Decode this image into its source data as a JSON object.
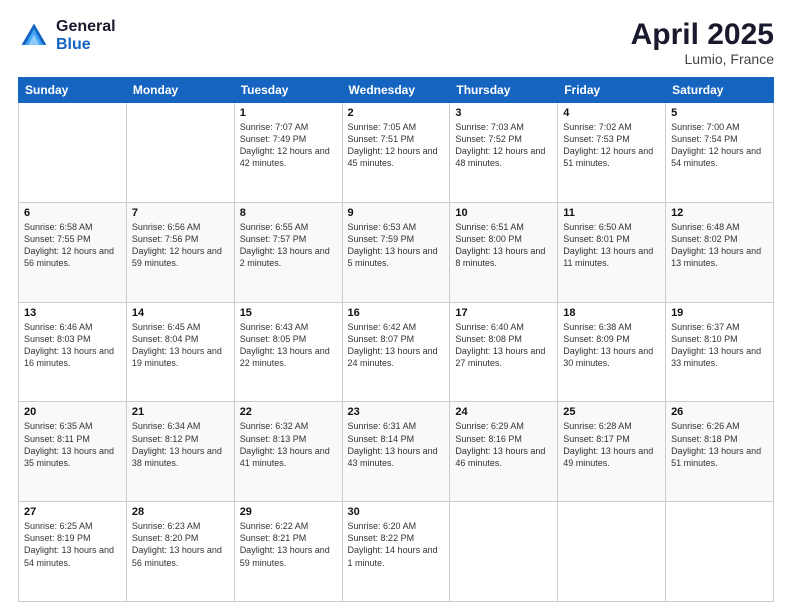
{
  "logo": {
    "general": "General",
    "blue": "Blue"
  },
  "title": "April 2025",
  "location": "Lumio, France",
  "days_of_week": [
    "Sunday",
    "Monday",
    "Tuesday",
    "Wednesday",
    "Thursday",
    "Friday",
    "Saturday"
  ],
  "weeks": [
    [
      {
        "day": "",
        "info": ""
      },
      {
        "day": "",
        "info": ""
      },
      {
        "day": "1",
        "info": "Sunrise: 7:07 AM\nSunset: 7:49 PM\nDaylight: 12 hours and 42 minutes."
      },
      {
        "day": "2",
        "info": "Sunrise: 7:05 AM\nSunset: 7:51 PM\nDaylight: 12 hours and 45 minutes."
      },
      {
        "day": "3",
        "info": "Sunrise: 7:03 AM\nSunset: 7:52 PM\nDaylight: 12 hours and 48 minutes."
      },
      {
        "day": "4",
        "info": "Sunrise: 7:02 AM\nSunset: 7:53 PM\nDaylight: 12 hours and 51 minutes."
      },
      {
        "day": "5",
        "info": "Sunrise: 7:00 AM\nSunset: 7:54 PM\nDaylight: 12 hours and 54 minutes."
      }
    ],
    [
      {
        "day": "6",
        "info": "Sunrise: 6:58 AM\nSunset: 7:55 PM\nDaylight: 12 hours and 56 minutes."
      },
      {
        "day": "7",
        "info": "Sunrise: 6:56 AM\nSunset: 7:56 PM\nDaylight: 12 hours and 59 minutes."
      },
      {
        "day": "8",
        "info": "Sunrise: 6:55 AM\nSunset: 7:57 PM\nDaylight: 13 hours and 2 minutes."
      },
      {
        "day": "9",
        "info": "Sunrise: 6:53 AM\nSunset: 7:59 PM\nDaylight: 13 hours and 5 minutes."
      },
      {
        "day": "10",
        "info": "Sunrise: 6:51 AM\nSunset: 8:00 PM\nDaylight: 13 hours and 8 minutes."
      },
      {
        "day": "11",
        "info": "Sunrise: 6:50 AM\nSunset: 8:01 PM\nDaylight: 13 hours and 11 minutes."
      },
      {
        "day": "12",
        "info": "Sunrise: 6:48 AM\nSunset: 8:02 PM\nDaylight: 13 hours and 13 minutes."
      }
    ],
    [
      {
        "day": "13",
        "info": "Sunrise: 6:46 AM\nSunset: 8:03 PM\nDaylight: 13 hours and 16 minutes."
      },
      {
        "day": "14",
        "info": "Sunrise: 6:45 AM\nSunset: 8:04 PM\nDaylight: 13 hours and 19 minutes."
      },
      {
        "day": "15",
        "info": "Sunrise: 6:43 AM\nSunset: 8:05 PM\nDaylight: 13 hours and 22 minutes."
      },
      {
        "day": "16",
        "info": "Sunrise: 6:42 AM\nSunset: 8:07 PM\nDaylight: 13 hours and 24 minutes."
      },
      {
        "day": "17",
        "info": "Sunrise: 6:40 AM\nSunset: 8:08 PM\nDaylight: 13 hours and 27 minutes."
      },
      {
        "day": "18",
        "info": "Sunrise: 6:38 AM\nSunset: 8:09 PM\nDaylight: 13 hours and 30 minutes."
      },
      {
        "day": "19",
        "info": "Sunrise: 6:37 AM\nSunset: 8:10 PM\nDaylight: 13 hours and 33 minutes."
      }
    ],
    [
      {
        "day": "20",
        "info": "Sunrise: 6:35 AM\nSunset: 8:11 PM\nDaylight: 13 hours and 35 minutes."
      },
      {
        "day": "21",
        "info": "Sunrise: 6:34 AM\nSunset: 8:12 PM\nDaylight: 13 hours and 38 minutes."
      },
      {
        "day": "22",
        "info": "Sunrise: 6:32 AM\nSunset: 8:13 PM\nDaylight: 13 hours and 41 minutes."
      },
      {
        "day": "23",
        "info": "Sunrise: 6:31 AM\nSunset: 8:14 PM\nDaylight: 13 hours and 43 minutes."
      },
      {
        "day": "24",
        "info": "Sunrise: 6:29 AM\nSunset: 8:16 PM\nDaylight: 13 hours and 46 minutes."
      },
      {
        "day": "25",
        "info": "Sunrise: 6:28 AM\nSunset: 8:17 PM\nDaylight: 13 hours and 49 minutes."
      },
      {
        "day": "26",
        "info": "Sunrise: 6:26 AM\nSunset: 8:18 PM\nDaylight: 13 hours and 51 minutes."
      }
    ],
    [
      {
        "day": "27",
        "info": "Sunrise: 6:25 AM\nSunset: 8:19 PM\nDaylight: 13 hours and 54 minutes."
      },
      {
        "day": "28",
        "info": "Sunrise: 6:23 AM\nSunset: 8:20 PM\nDaylight: 13 hours and 56 minutes."
      },
      {
        "day": "29",
        "info": "Sunrise: 6:22 AM\nSunset: 8:21 PM\nDaylight: 13 hours and 59 minutes."
      },
      {
        "day": "30",
        "info": "Sunrise: 6:20 AM\nSunset: 8:22 PM\nDaylight: 14 hours and 1 minute."
      },
      {
        "day": "",
        "info": ""
      },
      {
        "day": "",
        "info": ""
      },
      {
        "day": "",
        "info": ""
      }
    ]
  ]
}
